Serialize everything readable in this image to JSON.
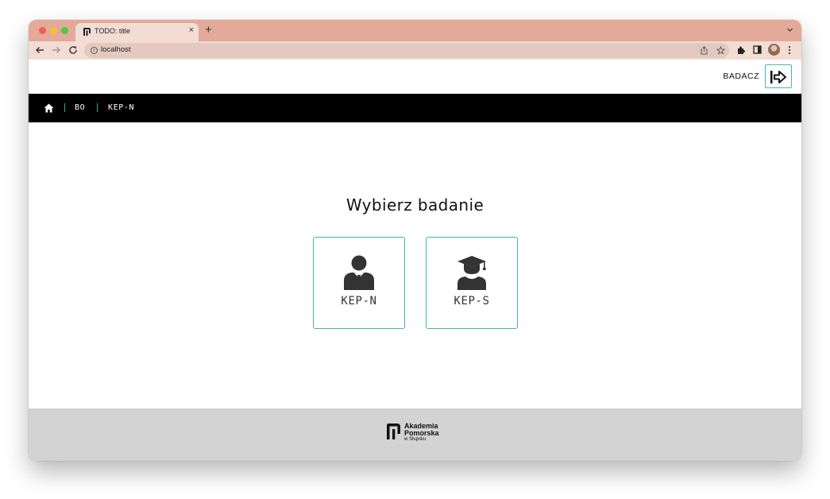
{
  "browser": {
    "tab_title": "TODO: title",
    "tab_close": "×",
    "new_tab": "+",
    "url": "localhost",
    "info_glyph": "i"
  },
  "header": {
    "user_role": "BADACZ",
    "logout_icon": "logout-icon"
  },
  "navbar": {
    "home_icon": "home-icon",
    "links": [
      {
        "label": "BO"
      },
      {
        "label": "KEP-N"
      }
    ]
  },
  "main": {
    "heading": "Wybierz badanie",
    "cards": [
      {
        "label": "KEP-N",
        "icon": "businessman-icon"
      },
      {
        "label": "KEP-S",
        "icon": "graduate-icon"
      }
    ]
  },
  "footer": {
    "logo_line1": "Akademia",
    "logo_line2": "Pomorska",
    "logo_line3": "w Słupsku"
  },
  "colors": {
    "accent": "#3fb6ac",
    "navbar": "#000000",
    "footer": "#d3d3d3",
    "tabstrip": "#e3aa99"
  }
}
